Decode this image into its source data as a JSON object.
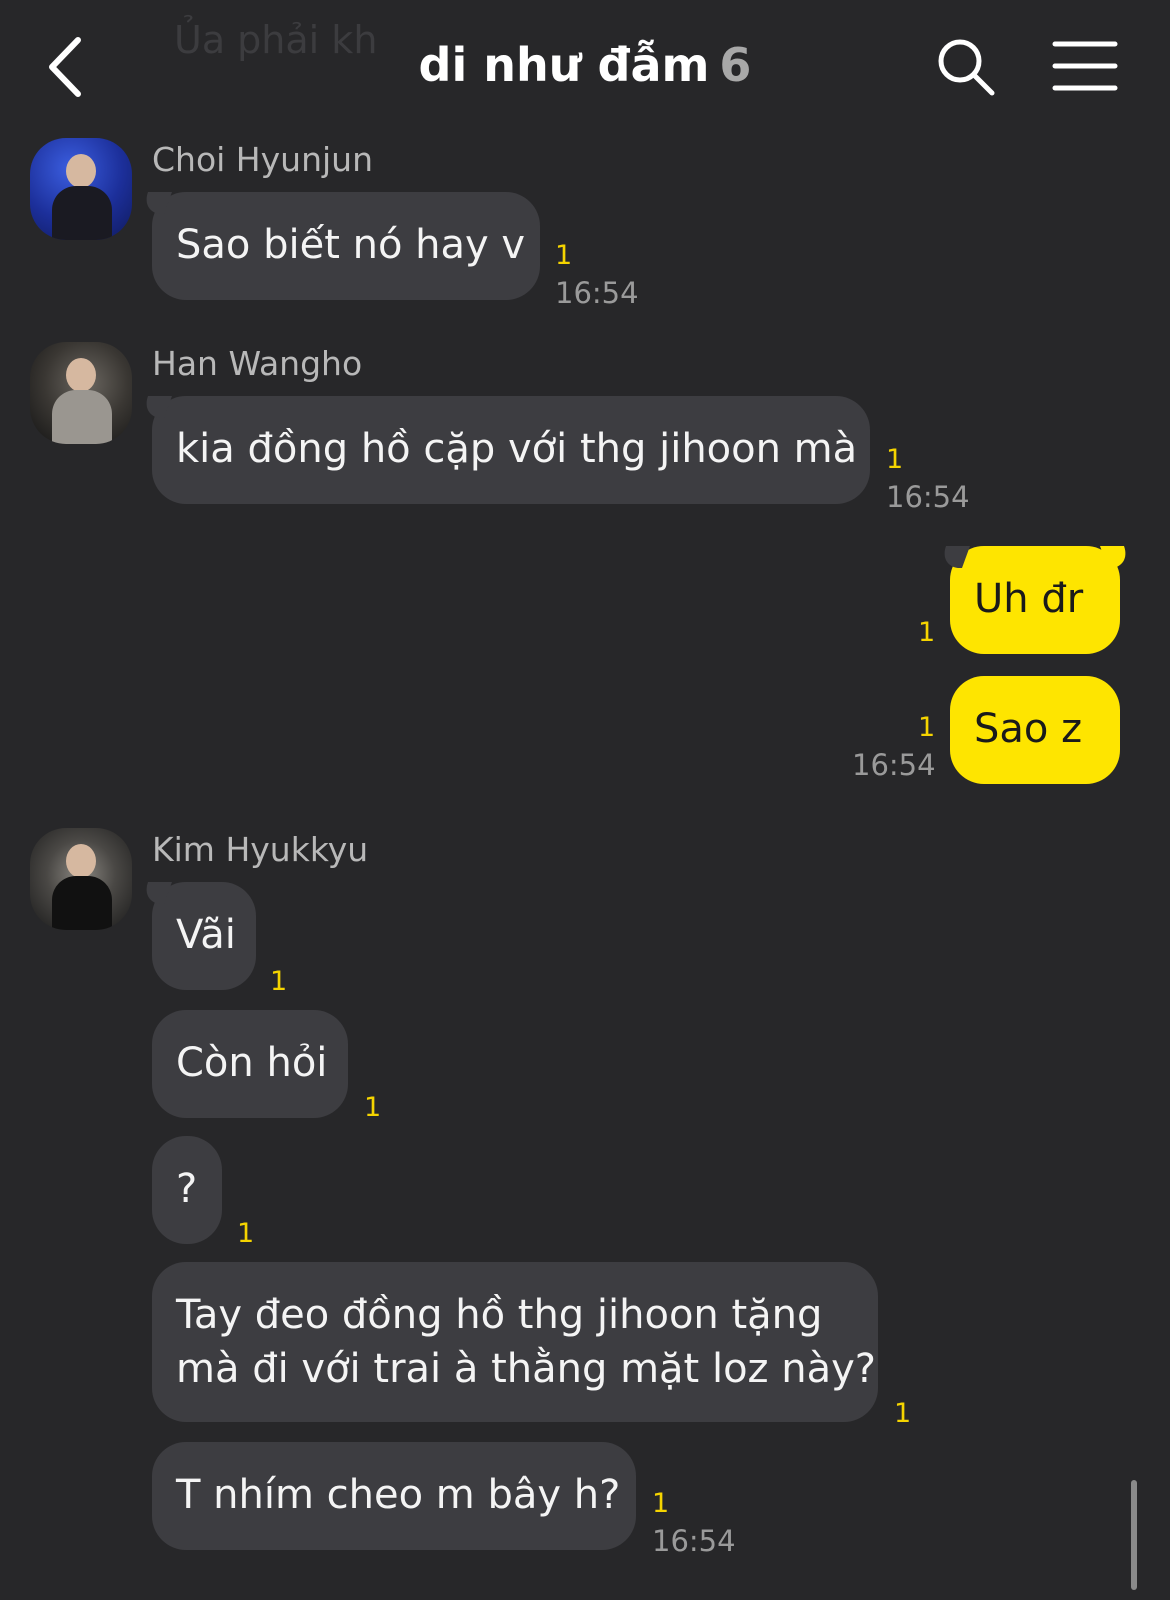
{
  "header": {
    "title": "di như đẫm",
    "member_count": "6",
    "ghost_text": "Ủa phải kh"
  },
  "icons": {
    "back": "chevron-left-icon",
    "search": "search-icon",
    "menu": "hamburger-menu-icon"
  },
  "colors": {
    "background": "#272729",
    "bubble_other": "#3d3d41",
    "bubble_me": "#fee500",
    "unread": "#f5d400"
  },
  "messages": {
    "m1": {
      "sender": "Choi Hyunjun",
      "text": "Sao biết nó hay v",
      "unread": "1",
      "time": "16:54"
    },
    "m2": {
      "sender": "Han Wangho",
      "text": "kia đồng hồ cặp với thg jihoon mà",
      "unread": "1",
      "time": "16:54"
    },
    "m3": {
      "text": "Uh đr",
      "unread": "1"
    },
    "m4": {
      "text": "Sao z",
      "unread": "1",
      "time": "16:54"
    },
    "m5": {
      "sender": "Kim Hyukkyu",
      "text": "Vãi",
      "unread": "1"
    },
    "m6": {
      "text": "Còn hỏi",
      "unread": "1"
    },
    "m7": {
      "text": "?",
      "unread": "1"
    },
    "m8": {
      "line1": "Tay đeo đồng hồ thg jihoon tặng",
      "line2": "mà đi với trai à thằng mặt loz này?",
      "unread": "1"
    },
    "m9": {
      "text": "T nhím cheo m bây h?",
      "unread": "1",
      "time": "16:54"
    }
  }
}
